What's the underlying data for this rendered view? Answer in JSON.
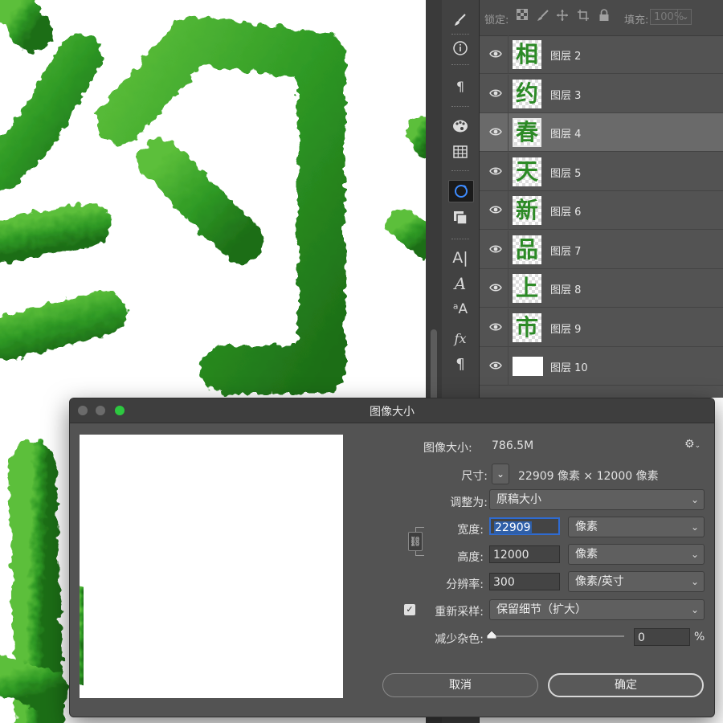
{
  "layers_panel": {
    "lock_label": "锁定:",
    "fill_label": "填充:",
    "fill_value": "100%",
    "layers": [
      {
        "glyph": "相",
        "name": "图层 2",
        "selected": false
      },
      {
        "glyph": "约",
        "name": "图层 3",
        "selected": false
      },
      {
        "glyph": "春",
        "name": "图层 4",
        "selected": true
      },
      {
        "glyph": "天",
        "name": "图层 5",
        "selected": false
      },
      {
        "glyph": "新",
        "name": "图层 6",
        "selected": false
      },
      {
        "glyph": "品",
        "name": "图层 7",
        "selected": false
      },
      {
        "glyph": "上",
        "name": "图层 8",
        "selected": false
      },
      {
        "glyph": "市",
        "name": "图层 9",
        "selected": false
      },
      {
        "glyph": "",
        "name": "图层 10",
        "selected": false
      }
    ]
  },
  "dialog": {
    "title": "图像大小",
    "image_size_label": "图像大小:",
    "image_size_value": "786.5M",
    "dimensions_label": "尺寸:",
    "dimensions_value": "22909 像素  ×  12000 像素",
    "fit_to_label": "调整为:",
    "fit_to_value": "原稿大小",
    "width_label": "宽度:",
    "width_value": "22909",
    "width_unit": "像素",
    "height_label": "高度:",
    "height_value": "12000",
    "height_unit": "像素",
    "resolution_label": "分辨率:",
    "resolution_value": "300",
    "resolution_unit": "像素/英寸",
    "resample_label": "重新采样:",
    "resample_checked": true,
    "resample_value": "保留细节（扩大）",
    "noise_label": "减少杂色:",
    "noise_value": "0",
    "noise_unit": "%",
    "cancel_label": "取消",
    "ok_label": "确定"
  }
}
